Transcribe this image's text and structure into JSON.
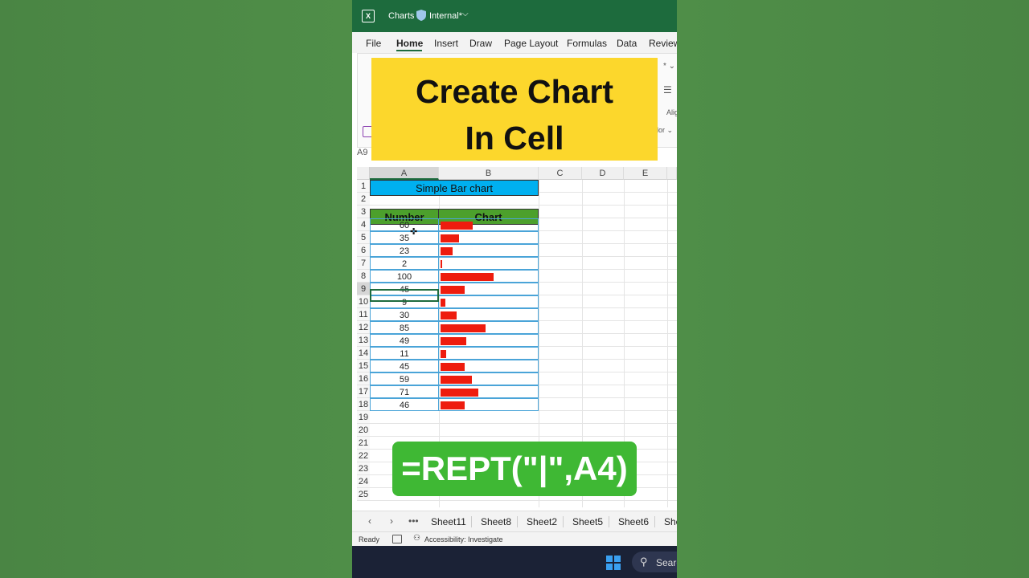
{
  "titlebar": {
    "app_name": "Charts",
    "label": "Internal*"
  },
  "menu": [
    "File",
    "Home",
    "Insert",
    "Draw",
    "Page Layout",
    "Formulas",
    "Data",
    "Review"
  ],
  "ribbon": {
    "frag_top": "* ⌄",
    "frag_align": "Alig",
    "frag_color": "lor ⌄"
  },
  "namebox": "A9",
  "banner": {
    "line1": "Create Chart",
    "line2": "In Cell"
  },
  "columns": [
    "A",
    "B",
    "C",
    "D",
    "E"
  ],
  "rows": [
    "1",
    "2",
    "3",
    "4",
    "5",
    "6",
    "7",
    "8",
    "9",
    "10",
    "11",
    "12",
    "13",
    "14",
    "15",
    "16",
    "17",
    "18",
    "19",
    "20",
    "21",
    "22",
    "23",
    "24",
    "25"
  ],
  "sheet": {
    "title": "Simple Bar chart",
    "header_number": "Number",
    "header_chart": "Chart",
    "values": [
      "60",
      "35",
      "23",
      "2",
      "100",
      "45",
      "9",
      "30",
      "85",
      "49",
      "11",
      "45",
      "59",
      "71",
      "46"
    ]
  },
  "chart_data": {
    "type": "bar",
    "categories": [
      "4",
      "5",
      "6",
      "7",
      "8",
      "9",
      "10",
      "11",
      "12",
      "13",
      "14",
      "15",
      "16",
      "17",
      "18"
    ],
    "values": [
      60,
      35,
      23,
      2,
      100,
      45,
      9,
      30,
      85,
      49,
      11,
      45,
      59,
      71,
      46
    ],
    "title": "Simple Bar chart",
    "xlabel": "",
    "ylabel": "",
    "bar_color": "#ee1c0e"
  },
  "formula": "=REPT(\"|\",A4)",
  "sheet_tabs": [
    "Sheet11",
    "Sheet8",
    "Sheet2",
    "Sheet5",
    "Sheet6",
    "She"
  ],
  "status": {
    "ready": "Ready",
    "accessibility": "Accessibility: Investigate"
  },
  "taskbar": {
    "search": "Searc"
  },
  "colors": {
    "titlebar": "#1d6b3d",
    "title_cell": "#00b0f0",
    "header_cell": "#4ca02c",
    "banner": "#fcd72c",
    "formula_bg": "#3fb834"
  }
}
